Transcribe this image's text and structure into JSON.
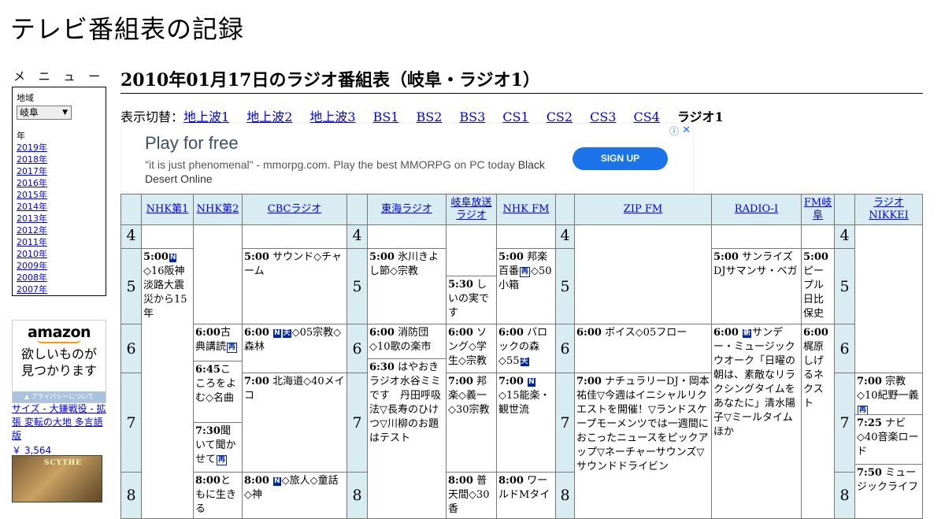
{
  "site": {
    "title": "テレビ番組表の記録"
  },
  "menu": {
    "heading": "メ ニ ュ ー",
    "region_label": "地域",
    "region_value": "岐阜",
    "year_label": "年",
    "years": [
      "2019年",
      "2018年",
      "2017年",
      "2016年",
      "2015年",
      "2014年",
      "2013年",
      "2012年",
      "2011年",
      "2010年",
      "2009年",
      "2008年",
      "2007年"
    ]
  },
  "ad_amazon": {
    "logo": "amazon",
    "line1": "欲しいものが",
    "line2": "見つかります",
    "privacy": "プライバシーについて",
    "product": "サイズ - 大鎌戦役 - 拡張 変転の大地 多言語版",
    "price": "￥ 3,564",
    "image_text": "SCYTHE"
  },
  "page": {
    "heading": "2010年01月17日のラジオ番組表（岐阜・ラジオ1）",
    "switch_label": "表示切替：",
    "switch_links": [
      "地上波1",
      "地上波2",
      "地上波3",
      "BS1",
      "BS2",
      "BS3",
      "CS1",
      "CS2",
      "CS3",
      "CS4"
    ],
    "switch_current": "ラジオ1"
  },
  "ad_banner": {
    "title": "Play for free",
    "text": "\"it is just phenomenal\" - mmorpg.com. Play the best MMORPG on PC today ",
    "text_dark": "Black Desert Online",
    "button": "SIGN UP",
    "info": "ⓘ",
    "close": "✕"
  },
  "schedule": {
    "stations": [
      "NHK第1",
      "NHK第2",
      "CBCラジオ",
      "東海ラジオ",
      "岐阜放送ラジオ",
      "NHK FM",
      "ZIP FM",
      "RADIO-I",
      "FM岐阜",
      "ラジオNIKKEI"
    ],
    "hours": [
      "4",
      "5",
      "6",
      "7",
      "8"
    ],
    "badges": {
      "news": "N",
      "new": "新",
      "sound": "天",
      "repeat": "再"
    },
    "programs": {
      "nhk1_500": {
        "time": "5:00",
        "title": "◇16阪神淡路大震災から15年"
      },
      "nhk2_600": {
        "time": "6:00",
        "title": "古典講読"
      },
      "nhk2_645": {
        "time": "6:45",
        "title": "こころをよむ◇名曲"
      },
      "nhk2_730": {
        "time": "7:30",
        "title": "聞いて聞かせて"
      },
      "nhk2_800": {
        "time": "8:00",
        "title": "ともに生きる"
      },
      "cbc_500": {
        "time": "5:00",
        "title": "サウンド◇チャーム"
      },
      "cbc_600": {
        "time": "6:00",
        "title": "◇05宗教◇森林"
      },
      "cbc_700": {
        "time": "7:00",
        "title": "北海道◇40メイコ"
      },
      "cbc_800": {
        "time": "8:00",
        "title": "◇旅人◇童話◇神"
      },
      "tokai_500": {
        "time": "5:00",
        "title": "氷川きよし節◇宗教"
      },
      "tokai_600": {
        "time": "6:00",
        "title": "消防団◇10歌の楽市"
      },
      "tokai_630": {
        "time": "6:30",
        "title": "はやおきラジオ水谷ミミです　丹田呼吸法▽長寿のひけつ▽川柳のお題はテスト"
      },
      "gifu_530": {
        "time": "5:30",
        "title": "しいの実です"
      },
      "gifu_600": {
        "time": "6:00",
        "title": "ソング◇学生◇宗教"
      },
      "gifu_700": {
        "time": "7:00",
        "title": "邦楽◇義一◇30宗教"
      },
      "gifu_800": {
        "time": "8:00",
        "title": "普天間◇30香"
      },
      "nhkfm_500": {
        "time": "5:00",
        "title_a": "邦楽百番",
        "title_b": "◇50小箱"
      },
      "nhkfm_600": {
        "time": "6:00",
        "title": "バロックの森◇55"
      },
      "nhkfm_700": {
        "time": "7:00",
        "title": "◇15能楽・観世流"
      },
      "nhkfm_800": {
        "time": "8:00",
        "title": "ワールドMタイ"
      },
      "zip_600": {
        "time": "6:00",
        "title": "ボイス◇05フロー"
      },
      "zip_700": {
        "time": "7:00",
        "title": "ナチュラリーDJ・岡本祐佳▽今週はイニシャルリクエストを開催！▽ランドスケープモーメンツでは一週間におこったニュースをピックアップ▽ネーチャーサウンズ▽サウンドドライビン"
      },
      "radioi_500": {
        "time": "5:00",
        "title": "サンライズDJサマンサ・ベガ"
      },
      "radioi_600": {
        "time": "6:00",
        "title": "サンデー・ミュージックウオーク「日曜の朝は、素敵なリラクシングタイムをあなたに」清水陽子▽ミールタイムほか"
      },
      "fmgifu_500": {
        "time": "5:00",
        "title": "ピープル日比保史"
      },
      "fmgifu_600": {
        "time": "6:00",
        "title": "梶原しげるネクスト"
      },
      "nikkei_700": {
        "time": "7:00",
        "title": "宗教◇10紀野一義"
      },
      "nikkei_725": {
        "time": "7:25",
        "title": "ナビ◇40音楽ロード"
      },
      "nikkei_750": {
        "time": "7:50",
        "title": "ミュージックライフ"
      }
    }
  }
}
